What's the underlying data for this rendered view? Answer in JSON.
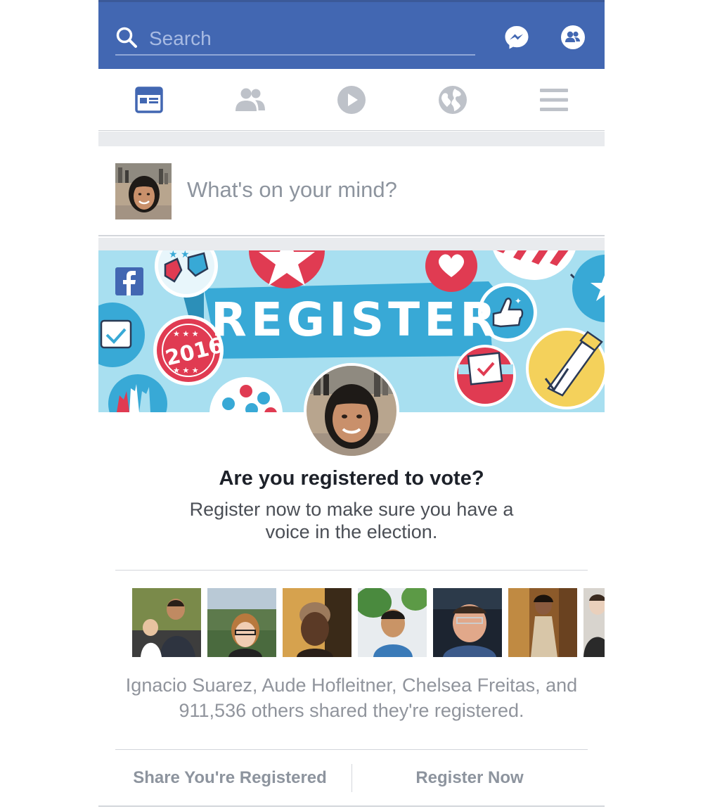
{
  "header": {
    "search_placeholder": "Search",
    "brand_color": "#4267b2"
  },
  "nav": {
    "tabs": [
      {
        "icon": "news-feed-icon",
        "active": true
      },
      {
        "icon": "friends-icon",
        "active": false
      },
      {
        "icon": "video-icon",
        "active": false
      },
      {
        "icon": "globe-icon",
        "active": false
      },
      {
        "icon": "menu-icon",
        "active": false
      }
    ],
    "active_color": "#4267b2",
    "inactive_color": "#bec2c9"
  },
  "composer": {
    "prompt": "What's on your mind?"
  },
  "register_card": {
    "banner_title": "REGISTER",
    "badge_year": "2016",
    "headline": "Are you registered to vote?",
    "subtitle": "Register now to make sure you have a voice in the election.",
    "friends_summary": "Ignacio Suarez, Aude Hofleitner, Chelsea Freitas, and 911,536 others shared they're registered.",
    "share_button": "Share You're Registered",
    "register_button": "Register Now"
  }
}
